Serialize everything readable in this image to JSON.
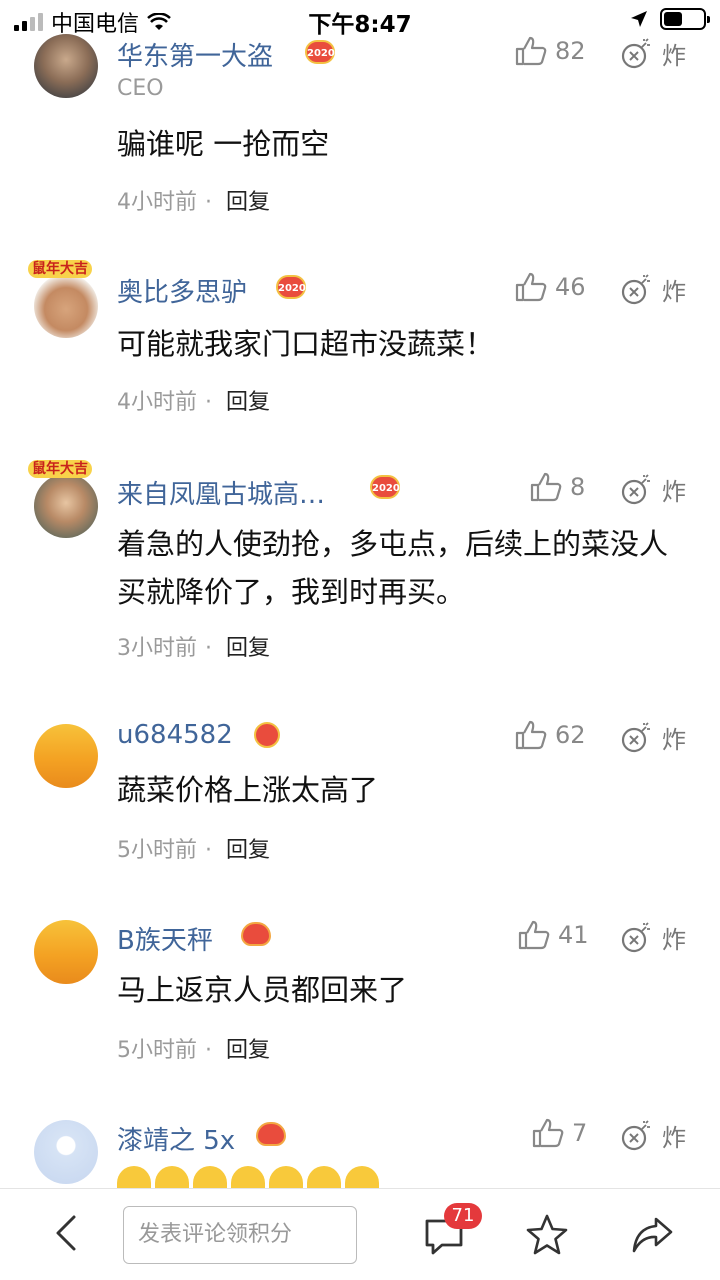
{
  "status": {
    "carrier": "中国电信",
    "time": "下午8:47"
  },
  "comments": [
    {
      "user": "华东第一大盗",
      "subtitle": "CEO",
      "badge": "2020",
      "likes": "82",
      "bomb_label": "炸",
      "text": "骗谁呢 一抢而空",
      "time": "4小时前",
      "reply": "回复"
    },
    {
      "user": "奥比多思驴",
      "badge": "2020",
      "avatar_hat": "鼠年大吉",
      "likes": "46",
      "bomb_label": "炸",
      "text": "可能就我家门口超市没蔬菜！",
      "time": "4小时前",
      "reply": "回复"
    },
    {
      "user": "来自凤凰古城高…",
      "badge": "2020",
      "avatar_hat": "鼠年大吉",
      "likes": "8",
      "bomb_label": "炸",
      "text": "着急的人使劲抢，多屯点，后续上的菜没人买就降价了，我到时再买。",
      "time": "3小时前",
      "reply": "回复"
    },
    {
      "user": "u684582",
      "likes": "62",
      "bomb_label": "炸",
      "text": "蔬菜价格上涨太高了",
      "time": "5小时前",
      "reply": "回复"
    },
    {
      "user": "B族天秤",
      "likes": "41",
      "bomb_label": "炸",
      "text": "马上返京人员都回来了",
      "time": "5小时前",
      "reply": "回复"
    },
    {
      "user": "漆靖之 5x",
      "likes": "7",
      "bomb_label": "炸"
    }
  ],
  "bottombar": {
    "placeholder": "发表评论领积分",
    "comment_count": "71"
  },
  "colors": {
    "username": "#406599",
    "badge_red": "#e4393c"
  }
}
